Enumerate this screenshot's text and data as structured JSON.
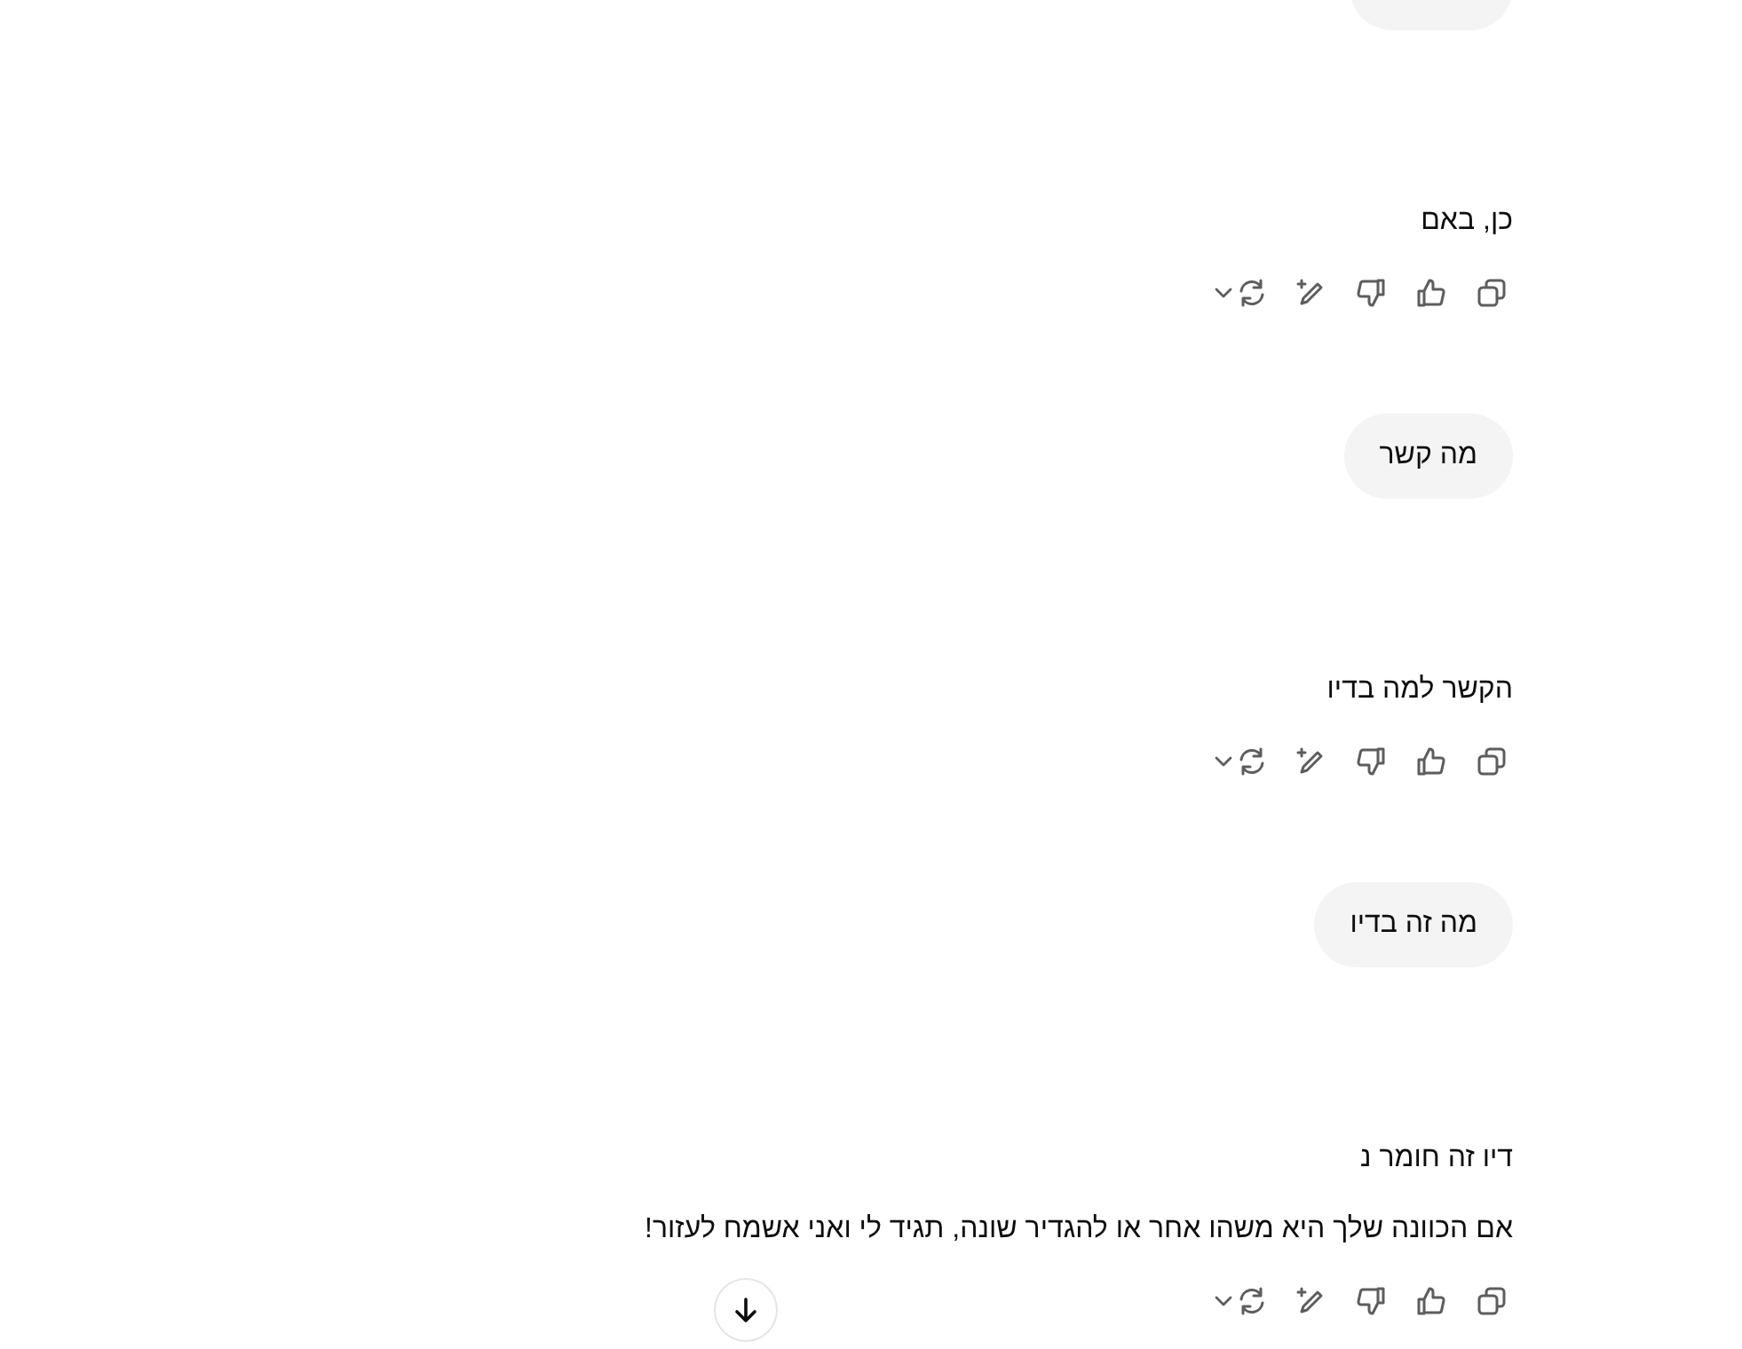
{
  "messages": [
    {
      "kind": "user_clipped"
    },
    {
      "kind": "assistant",
      "paragraphs": [
        "כן, באם"
      ]
    },
    {
      "kind": "user",
      "text": "מה קשר"
    },
    {
      "kind": "assistant",
      "paragraphs": [
        "הקשר למה בדיו"
      ]
    },
    {
      "kind": "user",
      "text": "מה זה בדיו"
    },
    {
      "kind": "assistant",
      "paragraphs": [
        "דיו זה חומר נ",
        "אם הכוונה שלך היא משהו אחר או להגדיר שונה, תגיד לי ואני אשמח לעזור!"
      ]
    }
  ]
}
